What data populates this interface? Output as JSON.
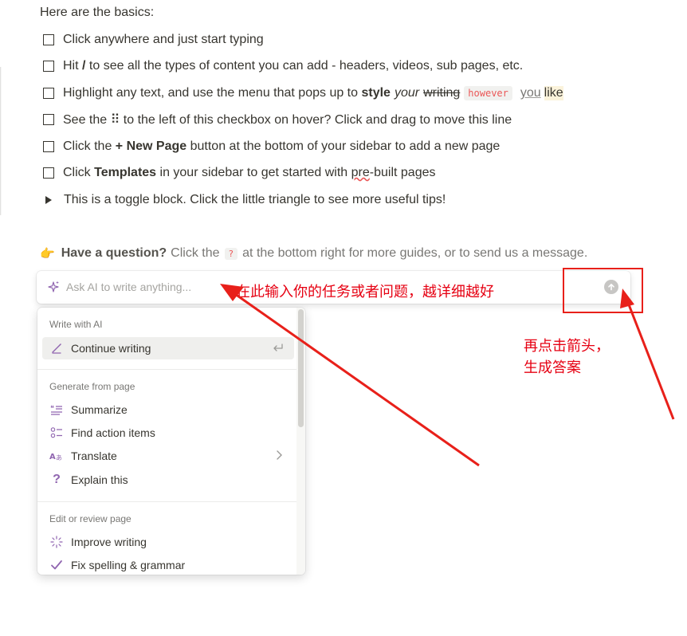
{
  "basics_heading": "Here are the basics:",
  "todos": [
    {
      "text": "Click anywhere and just start typing"
    },
    {
      "pre": "Hit ",
      "bold": "/",
      "post": " to see all the types of content you can add - headers, videos, sub pages, etc."
    },
    {
      "pre": "Highlight any text, and use the menu that pops up to ",
      "bold": "style",
      "italic": "your",
      "strike": "writing",
      "code": "however",
      "underline": "you",
      "highlight": "like"
    },
    {
      "pre": "See the ",
      "handle": "⠿",
      "post": " to the left of this checkbox on hover? Click and drag to move this line"
    },
    {
      "pre": "Click the ",
      "bold": "+ New Page",
      "post": " button at the bottom of your sidebar to add a new page"
    },
    {
      "pre": "Click ",
      "bold": "Templates",
      "mid": " in your sidebar to get started with ",
      "squiggle": "pre",
      "post": "-built pages"
    }
  ],
  "toggle": {
    "text": "This is a toggle block. Click the little triangle to see more useful tips!"
  },
  "question": {
    "emoji": "👉",
    "bold": "Have a question?",
    "pre": "Click the",
    "code": "?",
    "post": "at the bottom right for more guides, or to send us a message."
  },
  "ai_bar": {
    "placeholder": "Ask AI to write anything...",
    "icon": "sparkle-icon",
    "send_icon": "arrow-up-circle-icon"
  },
  "ai_menu": {
    "sections": [
      {
        "label": "Write with AI",
        "items": [
          {
            "label": "Continue writing",
            "icon": "pen-line-icon",
            "shortcut_icon": "enter-icon"
          }
        ]
      },
      {
        "label": "Generate from page",
        "items": [
          {
            "label": "Summarize",
            "icon": "summarize-icon"
          },
          {
            "label": "Find action items",
            "icon": "checklist-icon"
          },
          {
            "label": "Translate",
            "icon": "translate-icon",
            "submenu": true
          },
          {
            "label": "Explain this",
            "icon": "question-icon"
          }
        ]
      },
      {
        "label": "Edit or review page",
        "items": [
          {
            "label": "Improve writing",
            "icon": "magic-wand-icon"
          },
          {
            "label": "Fix spelling & grammar",
            "icon": "checkmark-icon"
          }
        ]
      }
    ]
  },
  "annotations": {
    "input_hint": "在此输入你的任务或者问题，越详细越好",
    "arrow_hint_line1": "再点击箭头，",
    "arrow_hint_line2": "生成答案"
  },
  "colors": {
    "text": "#37352f",
    "muted": "#787774",
    "annotation": "#e60012",
    "code": "#eb5757",
    "ai_purple": "#9065b0"
  }
}
